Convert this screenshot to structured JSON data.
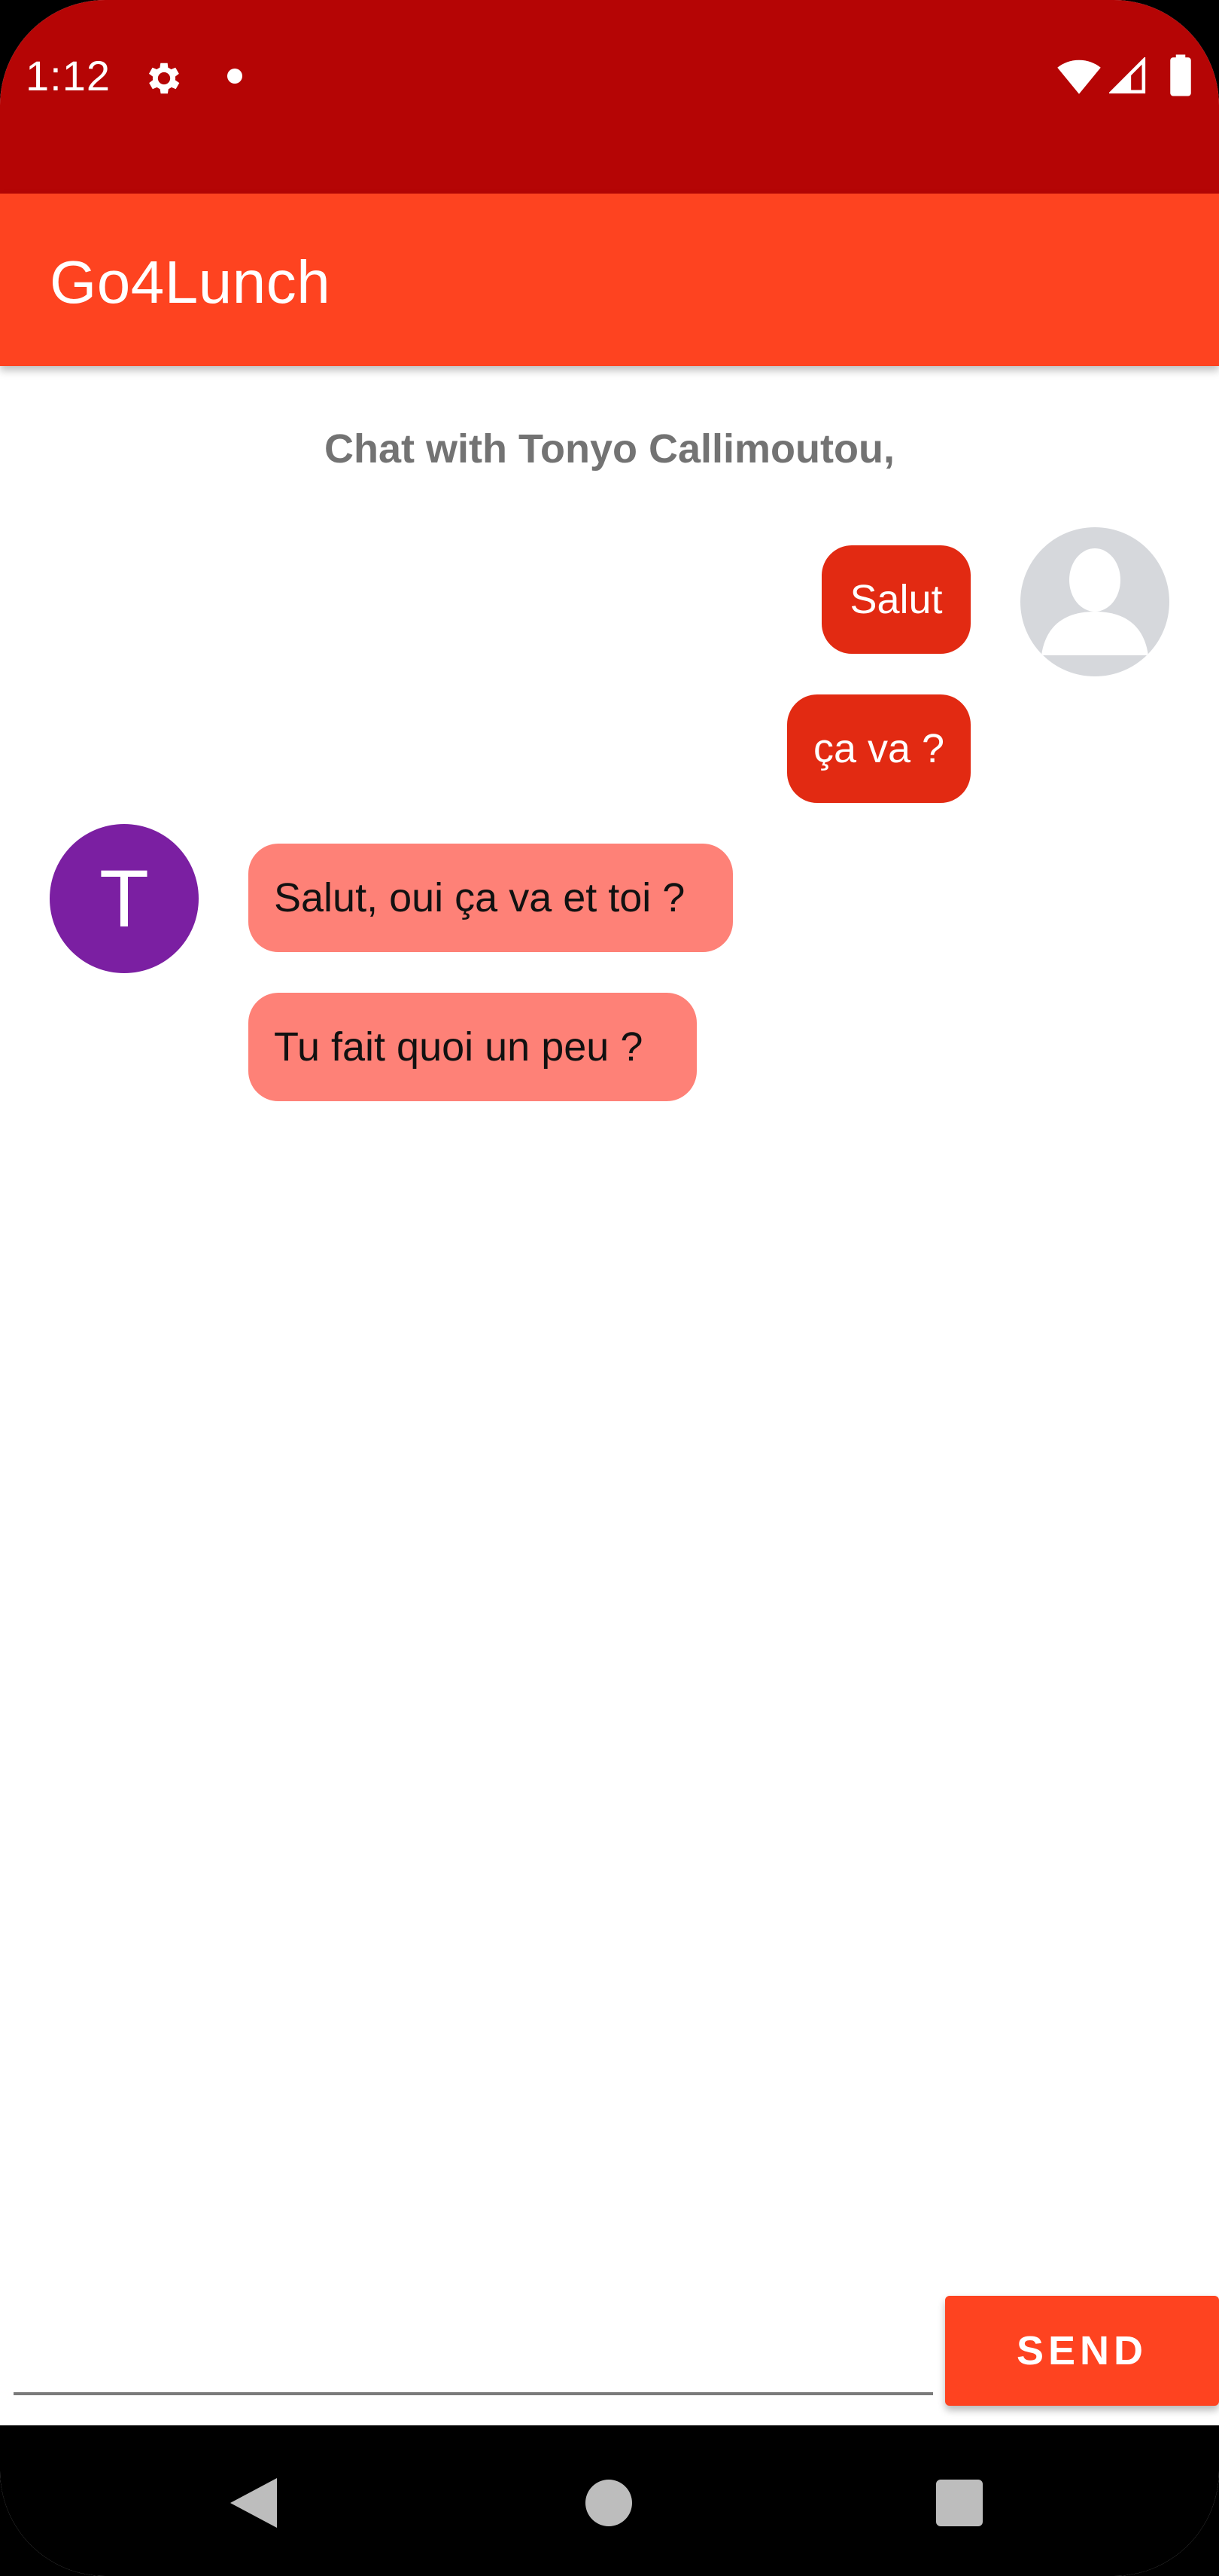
{
  "status_bar": {
    "time": "1:12",
    "icons": [
      "gear-icon",
      "notification-dot-icon",
      "wifi-icon",
      "signal-icon",
      "battery-icon"
    ],
    "color": "#b50505"
  },
  "app_bar": {
    "title": "Go4Lunch",
    "color": "#fe4320"
  },
  "chat": {
    "header": "Chat with Tonyo Callimoutou,",
    "messages": [
      {
        "sender": "me",
        "text": "Salut"
      },
      {
        "sender": "me",
        "text": "ça va ?"
      },
      {
        "sender": "other",
        "text": "Salut, oui ça va et toi ?"
      },
      {
        "sender": "other",
        "text": "Tu fait quoi un peu ?"
      }
    ],
    "other_avatar_initial": "T",
    "colors": {
      "sent_bubble": "#e22a12",
      "received_bubble": "#fe8177",
      "other_avatar": "#7b1fa2"
    }
  },
  "composer": {
    "input_value": "",
    "send_label": "SEND"
  },
  "nav_bar": {
    "buttons": [
      "back-icon",
      "home-icon",
      "recents-icon"
    ]
  }
}
